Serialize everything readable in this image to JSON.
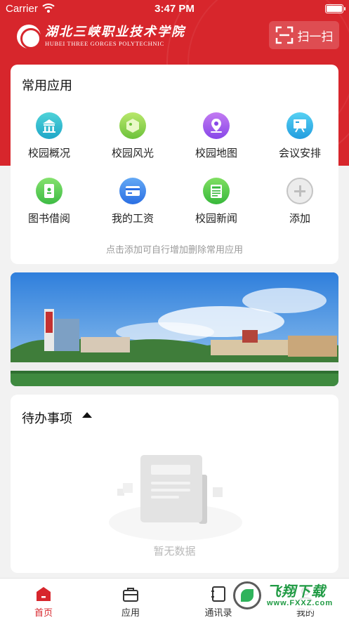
{
  "status_bar": {
    "carrier": "Carrier",
    "time": "3:47 PM"
  },
  "header": {
    "school_name_cn": "湖北三峡职业技术学院",
    "school_name_en": "HUBEI THREE GORGES POLYTECHNIC",
    "scan_label": "扫一扫"
  },
  "common_apps": {
    "title": "常用应用",
    "items": [
      {
        "label": "校园概况",
        "icon": "building-icon"
      },
      {
        "label": "校园风光",
        "icon": "scenery-icon"
      },
      {
        "label": "校园地图",
        "icon": "map-pin-icon"
      },
      {
        "label": "会议安排",
        "icon": "meeting-board-icon"
      },
      {
        "label": "图书借阅",
        "icon": "book-icon"
      },
      {
        "label": "我的工资",
        "icon": "salary-card-icon"
      },
      {
        "label": "校园新闻",
        "icon": "news-icon"
      },
      {
        "label": "添加",
        "icon": "add-icon"
      }
    ],
    "hint": "点击添加可自行增加删除常用应用"
  },
  "todo": {
    "title": "待办事项",
    "empty_text": "暂无数据"
  },
  "tabbar": {
    "items": [
      {
        "label": "首页",
        "icon": "home-icon",
        "active": true
      },
      {
        "label": "应用",
        "icon": "briefcase-icon",
        "active": false
      },
      {
        "label": "通讯录",
        "icon": "contacts-icon",
        "active": false
      },
      {
        "label": "我的",
        "icon": "profile-icon",
        "active": false
      }
    ]
  },
  "watermark": {
    "cn": "飞翔下载",
    "en": "www.FXXZ.com"
  },
  "colors": {
    "brand_red": "#d7262c",
    "page_bg": "#f2f2f2"
  }
}
